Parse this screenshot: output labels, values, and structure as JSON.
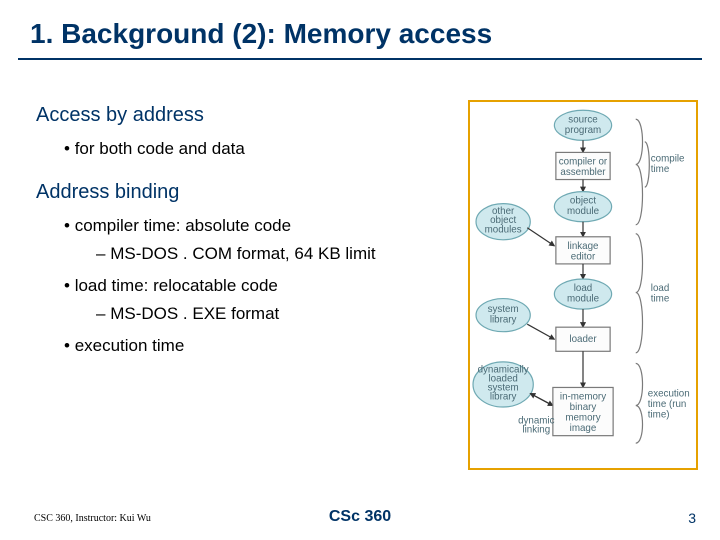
{
  "title": "1. Background (2): Memory access",
  "sections": [
    {
      "heading": "Access by address",
      "bullets": [
        {
          "text": "for both code and data",
          "subs": []
        }
      ]
    },
    {
      "heading": "Address binding",
      "bullets": [
        {
          "text": "compiler time: absolute code",
          "subs": [
            "MS-DOS . COM format, 64 KB limit"
          ]
        },
        {
          "text": "load time: relocatable code",
          "subs": [
            "MS-DOS . EXE format"
          ]
        },
        {
          "text": "execution time",
          "subs": []
        }
      ]
    }
  ],
  "diagram": {
    "nodes": {
      "source_program": "source\nprogram",
      "compiler": "compiler or\nassembler",
      "object_module": "object\nmodule",
      "other_modules": "other\nobject\nmodules",
      "linkage_editor": "linkage\neditor",
      "load_module": "load\nmodule",
      "system_library": "system\nlibrary",
      "loader": "loader",
      "dyn_library": "dynamically\nloaded\nsystem\nlibrary",
      "memory_image": "in-memory\nbinary\nmemory\nimage",
      "dynamic_linking": "dynamic\nlinking"
    },
    "side_labels": {
      "compile_time": "compile\ntime",
      "load_time": "load\ntime",
      "run_time": "execution\ntime (run\ntime)"
    }
  },
  "footer": {
    "left": "CSC 360, Instructor: Kui Wu",
    "center": "CSc 360",
    "right": "3"
  }
}
